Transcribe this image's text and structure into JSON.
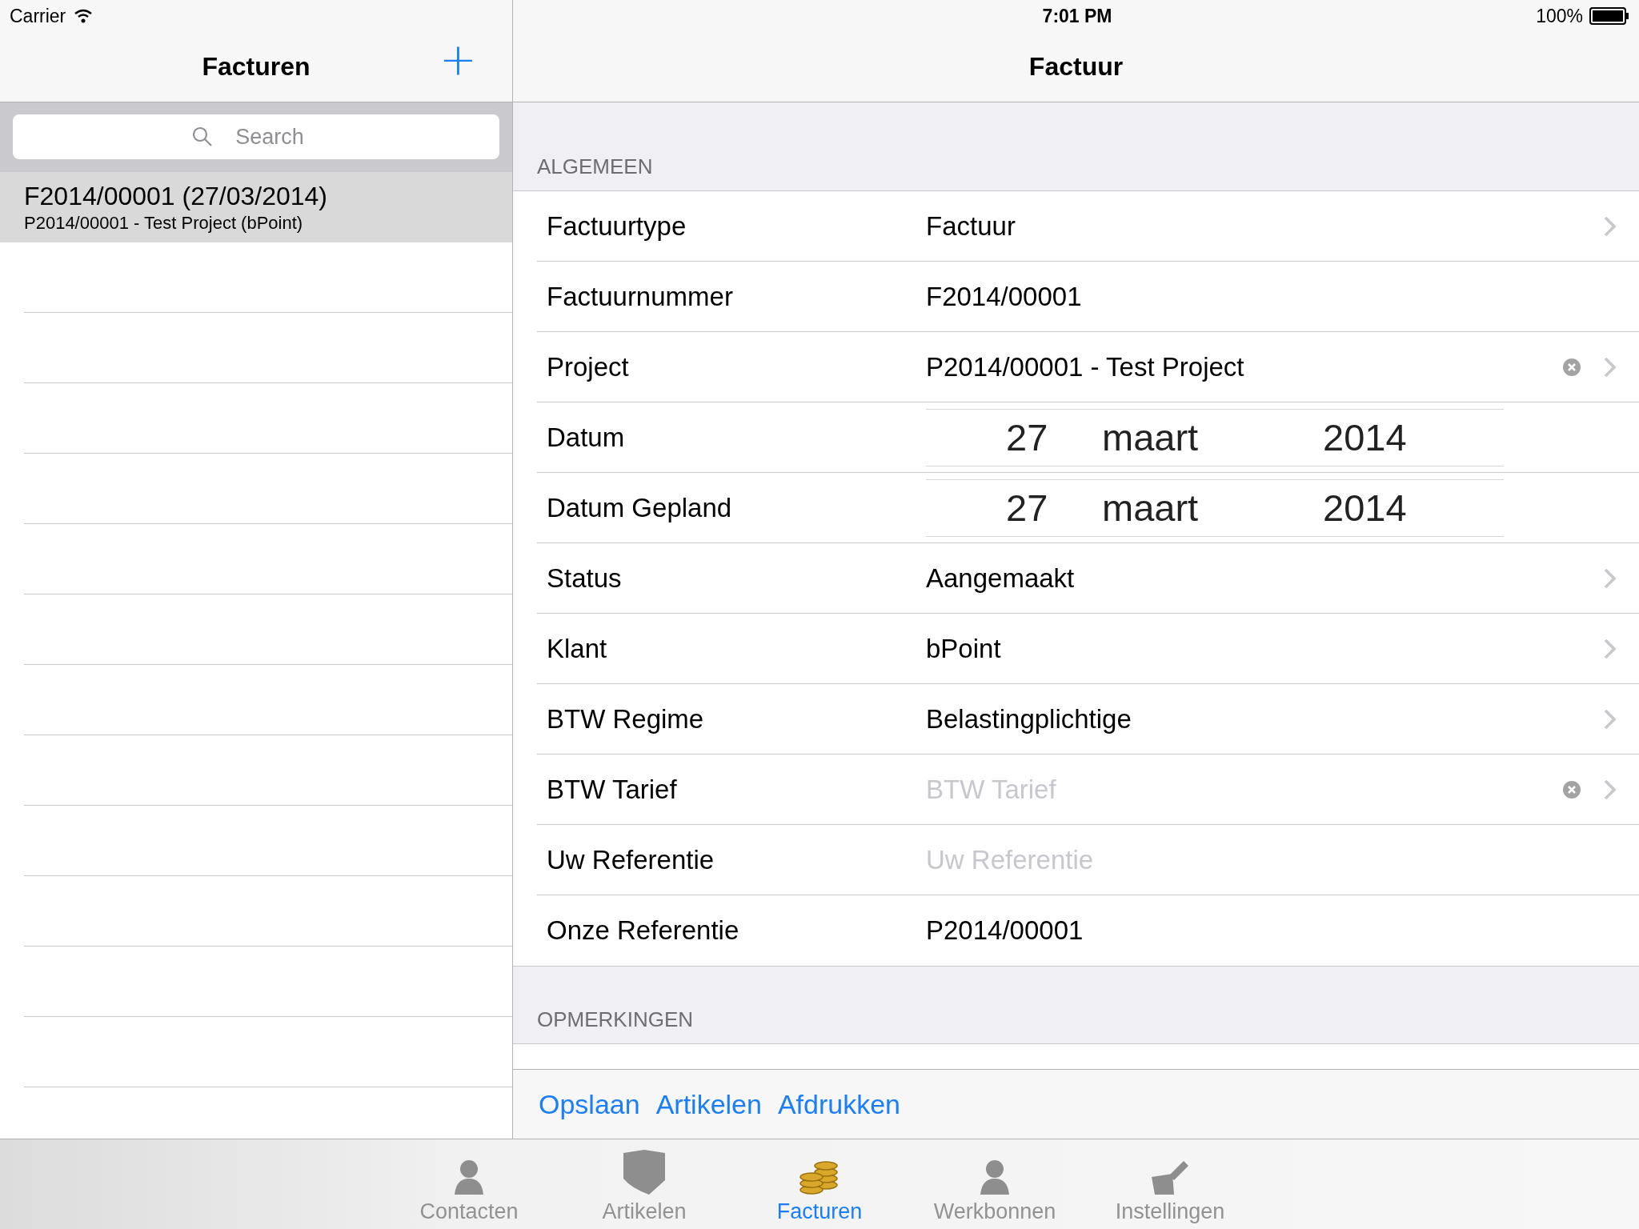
{
  "status_bar": {
    "carrier": "Carrier",
    "time": "7:01 PM",
    "battery": "100%"
  },
  "master": {
    "title": "Facturen",
    "add_button": "+",
    "search": {
      "placeholder": "Search"
    },
    "items": [
      {
        "title": "F2014/00001 (27/03/2014)",
        "subtitle": "P2014/00001 - Test Project (bPoint)",
        "selected": true
      }
    ]
  },
  "detail": {
    "title": "Factuur",
    "sections": [
      {
        "header": "ALGEMEEN",
        "rows": [
          {
            "kind": "disclosure",
            "label": "Factuurtype",
            "value": "Factuur",
            "clearable": false
          },
          {
            "kind": "text",
            "label": "Factuurnummer",
            "value": "F2014/00001"
          },
          {
            "kind": "disclosure",
            "label": "Project",
            "value": "P2014/00001 - Test Project",
            "clearable": true
          },
          {
            "kind": "date",
            "label": "Datum",
            "day": "27",
            "month": "maart",
            "year": "2014"
          },
          {
            "kind": "date",
            "label": "Datum Gepland",
            "day": "27",
            "month": "maart",
            "year": "2014"
          },
          {
            "kind": "disclosure",
            "label": "Status",
            "value": "Aangemaakt",
            "clearable": false
          },
          {
            "kind": "disclosure",
            "label": "Klant",
            "value": "bPoint",
            "clearable": false
          },
          {
            "kind": "disclosure",
            "label": "BTW Regime",
            "value": "Belastingplichtige",
            "clearable": false
          },
          {
            "kind": "disclosure",
            "label": "BTW Tarief",
            "placeholder": "BTW Tarief",
            "clearable": true
          },
          {
            "kind": "text",
            "label": "Uw Referentie",
            "placeholder": "Uw Referentie"
          },
          {
            "kind": "text",
            "label": "Onze Referentie",
            "value": "P2014/00001"
          }
        ]
      },
      {
        "header": "OPMERKINGEN"
      }
    ],
    "actions": [
      "Opslaan",
      "Artikelen",
      "Afdrukken"
    ]
  },
  "tab_bar": [
    {
      "label": "Contacten",
      "selected": false
    },
    {
      "label": "Artikelen",
      "selected": false
    },
    {
      "label": "Facturen",
      "selected": true
    },
    {
      "label": "Werkbonnen",
      "selected": false
    },
    {
      "label": "Instellingen",
      "selected": false
    }
  ]
}
